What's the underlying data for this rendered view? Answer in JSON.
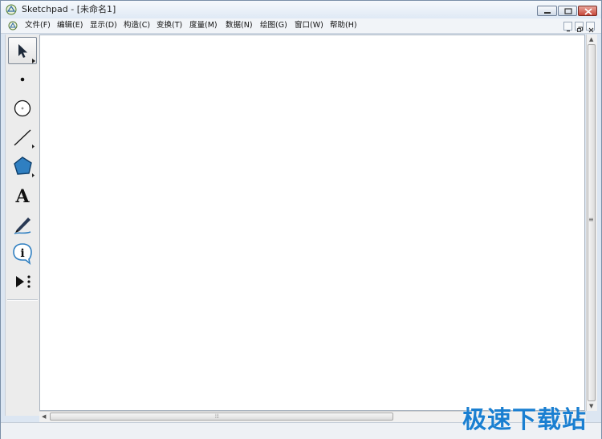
{
  "window": {
    "title": "Sketchpad  - [未命名1]"
  },
  "menu": {
    "items": [
      {
        "label": "文件(F)"
      },
      {
        "label": "编辑(E)"
      },
      {
        "label": "显示(D)"
      },
      {
        "label": "构造(C)"
      },
      {
        "label": "变换(T)"
      },
      {
        "label": "度量(M)"
      },
      {
        "label": "数据(N)"
      },
      {
        "label": "绘图(G)"
      },
      {
        "label": "窗口(W)"
      },
      {
        "label": "帮助(H)"
      }
    ]
  },
  "tools": [
    {
      "icon": "arrow-select-icon",
      "active": true
    },
    {
      "icon": "point-icon"
    },
    {
      "icon": "compass-circle-icon"
    },
    {
      "icon": "straightedge-line-icon"
    },
    {
      "icon": "polygon-icon"
    },
    {
      "icon": "text-tool-icon",
      "glyph": "A"
    },
    {
      "icon": "marker-pen-icon"
    },
    {
      "icon": "information-icon",
      "glyph": "i"
    },
    {
      "icon": "custom-tool-icon"
    }
  ],
  "scroll": {
    "h_grip": "⦙⦙⦙",
    "v_grip": "≡"
  },
  "watermark": {
    "text": "极速下载站"
  },
  "colors": {
    "accent": "#1a7fd1",
    "polygon_fill": "#2f7fc1"
  }
}
